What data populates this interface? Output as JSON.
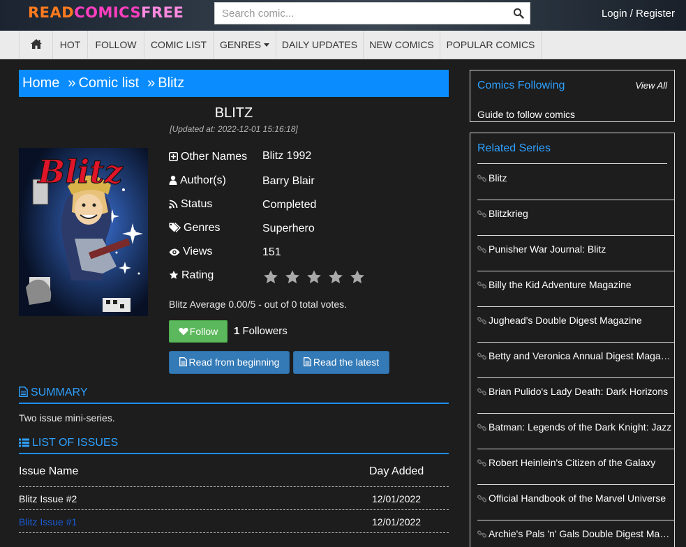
{
  "header": {
    "logo_parts": [
      "READ",
      "COMICS",
      "FREE"
    ],
    "search_placeholder": "Search comic...",
    "login": "Login / Register"
  },
  "nav": {
    "items": [
      "HOT",
      "FOLLOW",
      "COMIC LIST",
      "GENRES",
      "DAILY UPDATES",
      "NEW COMICS",
      "POPULAR COMICS"
    ]
  },
  "breadcrumb": [
    "Home",
    "Comic list",
    "Blitz"
  ],
  "breadcrumb_sep": "»",
  "comic": {
    "title": "BLITZ",
    "updated": "[Updated at: 2022-12-01 15:16:18]",
    "labels": {
      "other_names": "Other Names",
      "authors": "Author(s)",
      "status": "Status",
      "genres": "Genres",
      "views": "Views",
      "rating": "Rating"
    },
    "other_names": "Blitz 1992",
    "authors": "Barry Blair",
    "status": "Completed",
    "genres": "Superhero",
    "views": "151",
    "rating_stars": 0,
    "rating_max": 5,
    "average": "Blitz Average 0.00/5 - out of 0 total votes.",
    "follow_label": "Follow",
    "followers_count": "1",
    "followers_label": "Followers",
    "read_first": "Read from beginning",
    "read_latest": "Read the latest",
    "cover_title": "Blitz"
  },
  "summary": {
    "heading": "SUMMARY",
    "text": "Two issue mini-series."
  },
  "issues": {
    "heading": "LIST OF ISSUES",
    "col_name": "Issue Name",
    "col_date": "Day Added",
    "rows": [
      {
        "name": "Blitz Issue #2",
        "date": "12/01/2022"
      },
      {
        "name": "Blitz Issue #1",
        "date": "12/01/2022"
      }
    ]
  },
  "sidebar": {
    "following_title": "Comics Following",
    "view_all": "View All",
    "guide": "Guide to follow comics",
    "related_title": "Related Series",
    "related": [
      "Blitz",
      "Blitzkrieg",
      "Punisher War Journal: Blitz",
      "Billy the Kid Adventure Magazine",
      "Jughead's Double Digest Magazine",
      "Betty and Veronica Annual Digest Magazine",
      "Brian Pulido's Lady Death: Dark Horizons",
      "Batman: Legends of the Dark Knight: Jazz",
      "Robert Heinlein's Citizen of the Galaxy",
      "Official Handbook of the Marvel Universe",
      "Archie's Pals 'n' Gals Double Digest Magazine"
    ]
  },
  "colors": {
    "accent": "#0a8cff",
    "follow_green": "#5cb85c",
    "button_blue": "#337ab7",
    "visited_link": "#1a5cd6",
    "background": "#1d1d1d"
  }
}
